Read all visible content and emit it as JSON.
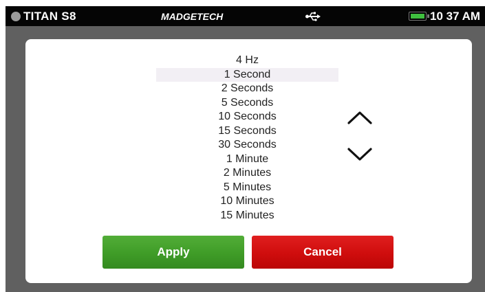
{
  "status_bar": {
    "device_name": "TITAN S8",
    "brand": "MADGETECH",
    "time": "10 37 AM",
    "usb_icon": "usb-icon",
    "battery_icon": "battery-icon",
    "battery_color": "#3fbf3f"
  },
  "dialog": {
    "options": [
      {
        "label": "4 Hz"
      },
      {
        "label": "1 Second",
        "selected": true
      },
      {
        "label": "2 Seconds"
      },
      {
        "label": "5 Seconds"
      },
      {
        "label": "10 Seconds"
      },
      {
        "label": "15 Seconds"
      },
      {
        "label": "30 Seconds"
      },
      {
        "label": "1 Minute"
      },
      {
        "label": "2 Minutes"
      },
      {
        "label": "5 Minutes"
      },
      {
        "label": "10 Minutes"
      },
      {
        "label": "15 Minutes"
      }
    ],
    "scroll_up_icon": "chevron-up-icon",
    "scroll_down_icon": "chevron-down-icon",
    "apply_label": "Apply",
    "cancel_label": "Cancel",
    "apply_color": "#3f9c27",
    "cancel_color": "#cf0d0d"
  }
}
